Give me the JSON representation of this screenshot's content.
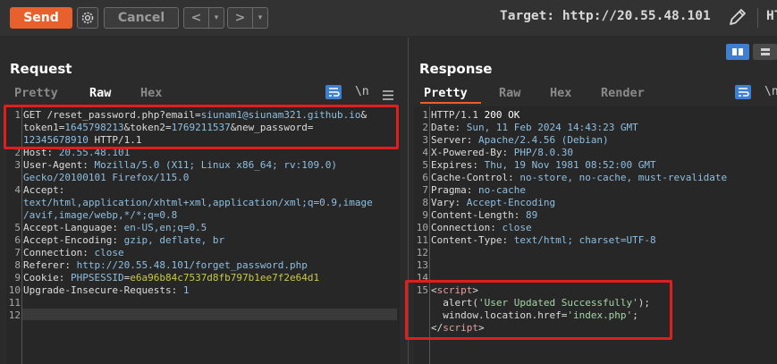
{
  "toolbar": {
    "send_label": "Send",
    "cancel_label": "Cancel",
    "back_label": "<",
    "forward_label": ">",
    "dropdown_arrow": "▾",
    "target_label": "Target: http://20.55.48.101",
    "cut_text": "HT",
    "icons": [
      "settings-gear-icon",
      "edit-pencil-icon"
    ]
  },
  "request": {
    "title": "Request",
    "tabs": [
      "Pretty",
      "Raw",
      "Hex"
    ],
    "active_tab": "Raw",
    "newline_toggle": "\\n",
    "lines": [
      {
        "n": "1",
        "parts": [
          {
            "t": "GET /reset_password.php?email=",
            "c": "k"
          },
          {
            "t": "siunam1@siunam321.github.io",
            "c": "v"
          },
          {
            "t": "&",
            "c": "k"
          }
        ]
      },
      {
        "n": "",
        "parts": [
          {
            "t": "token1=",
            "c": "k"
          },
          {
            "t": "1645798213",
            "c": "v"
          },
          {
            "t": "&token2=",
            "c": "k"
          },
          {
            "t": "1769211537",
            "c": "v"
          },
          {
            "t": "&new_password=",
            "c": "k"
          }
        ]
      },
      {
        "n": "",
        "parts": [
          {
            "t": "12345678910",
            "c": "v"
          },
          {
            "t": " HTTP/1.1",
            "c": "k"
          }
        ]
      },
      {
        "n": "2",
        "parts": [
          {
            "t": "Host: ",
            "c": "k"
          },
          {
            "t": "20.55.48.101",
            "c": "v"
          }
        ]
      },
      {
        "n": "3",
        "parts": [
          {
            "t": "User-Agent: ",
            "c": "k"
          },
          {
            "t": "Mozilla/5.0 (X11; Linux x86_64; rv:109.0)",
            "c": "v"
          }
        ]
      },
      {
        "n": "",
        "parts": [
          {
            "t": "Gecko/20100101 Firefox/115.0",
            "c": "v"
          }
        ]
      },
      {
        "n": "4",
        "parts": [
          {
            "t": "Accept:",
            "c": "k"
          }
        ]
      },
      {
        "n": "",
        "parts": [
          {
            "t": "text/html,application/xhtml+xml,application/xml;q=0.9,image",
            "c": "v"
          }
        ]
      },
      {
        "n": "",
        "parts": [
          {
            "t": "/avif,image/webp,*/*;q=0.8",
            "c": "v"
          }
        ]
      },
      {
        "n": "5",
        "parts": [
          {
            "t": "Accept-Language: ",
            "c": "k"
          },
          {
            "t": "en-US,en;q=0.5",
            "c": "v"
          }
        ]
      },
      {
        "n": "6",
        "parts": [
          {
            "t": "Accept-Encoding: ",
            "c": "k"
          },
          {
            "t": "gzip, deflate, br",
            "c": "v"
          }
        ]
      },
      {
        "n": "7",
        "parts": [
          {
            "t": "Connection: ",
            "c": "k"
          },
          {
            "t": "close",
            "c": "v"
          }
        ]
      },
      {
        "n": "8",
        "parts": [
          {
            "t": "Referer: ",
            "c": "k"
          },
          {
            "t": "http://20.55.48.101/forget_password.php",
            "c": "v"
          }
        ]
      },
      {
        "n": "9",
        "parts": [
          {
            "t": "Cookie: ",
            "c": "k"
          },
          {
            "t": "PHPSESSID",
            "c": "v"
          },
          {
            "t": "=",
            "c": "k"
          },
          {
            "t": "e6a96b84c7537d8fb797b1ee7f2e64d1",
            "c": "pv"
          }
        ]
      },
      {
        "n": "10",
        "parts": [
          {
            "t": "Upgrade-Insecure-Requests: ",
            "c": "k"
          },
          {
            "t": "1",
            "c": "v"
          }
        ]
      },
      {
        "n": "11",
        "parts": []
      },
      {
        "n": "12",
        "parts": []
      }
    ]
  },
  "response": {
    "title": "Response",
    "tabs": [
      "Pretty",
      "Raw",
      "Hex",
      "Render"
    ],
    "active_tab": "Pretty",
    "newline_toggle": "\\n",
    "lines": [
      {
        "n": "1",
        "parts": [
          {
            "t": "HTTP/1.1 ",
            "c": "k"
          },
          {
            "t": "200 OK",
            "c": "ok"
          }
        ]
      },
      {
        "n": "2",
        "parts": [
          {
            "t": "Date: ",
            "c": "k"
          },
          {
            "t": "Sun, 11 Feb 2024 14:43:23 GMT",
            "c": "v"
          }
        ]
      },
      {
        "n": "3",
        "parts": [
          {
            "t": "Server: ",
            "c": "k"
          },
          {
            "t": "Apache/2.4.56 (Debian)",
            "c": "v"
          }
        ]
      },
      {
        "n": "4",
        "parts": [
          {
            "t": "X-Powered-By: ",
            "c": "k"
          },
          {
            "t": "PHP/8.0.30",
            "c": "v"
          }
        ]
      },
      {
        "n": "5",
        "parts": [
          {
            "t": "Expires: ",
            "c": "k"
          },
          {
            "t": "Thu, 19 Nov 1981 08:52:00 GMT",
            "c": "v"
          }
        ]
      },
      {
        "n": "6",
        "parts": [
          {
            "t": "Cache-Control: ",
            "c": "k"
          },
          {
            "t": "no-store, no-cache, must-revalidate",
            "c": "v"
          }
        ]
      },
      {
        "n": "7",
        "parts": [
          {
            "t": "Pragma: ",
            "c": "k"
          },
          {
            "t": "no-cache",
            "c": "v"
          }
        ]
      },
      {
        "n": "8",
        "parts": [
          {
            "t": "Vary: ",
            "c": "k"
          },
          {
            "t": "Accept-Encoding",
            "c": "v"
          }
        ]
      },
      {
        "n": "9",
        "parts": [
          {
            "t": "Content-Length: ",
            "c": "k"
          },
          {
            "t": "89",
            "c": "v"
          }
        ]
      },
      {
        "n": "10",
        "parts": [
          {
            "t": "Connection: ",
            "c": "k"
          },
          {
            "t": "close",
            "c": "v"
          }
        ]
      },
      {
        "n": "11",
        "parts": [
          {
            "t": "Content-Type: ",
            "c": "k"
          },
          {
            "t": "text/html; charset=UTF-8",
            "c": "v"
          }
        ]
      },
      {
        "n": "12",
        "parts": []
      },
      {
        "n": "13",
        "parts": []
      },
      {
        "n": "14",
        "parts": []
      },
      {
        "n": "15",
        "parts": [
          {
            "t": "<",
            "c": "k"
          },
          {
            "t": "script",
            "c": "tagc"
          },
          {
            "t": ">",
            "c": "k"
          }
        ]
      },
      {
        "n": "",
        "parts": [
          {
            "t": "  alert(",
            "c": "k"
          },
          {
            "t": "'User Updated Successfully'",
            "c": "str"
          },
          {
            "t": ");",
            "c": "k"
          }
        ]
      },
      {
        "n": "",
        "parts": [
          {
            "t": "  window.location.href=",
            "c": "k"
          },
          {
            "t": "'index.php'",
            "c": "str"
          },
          {
            "t": ";",
            "c": "k"
          }
        ]
      },
      {
        "n": "",
        "parts": [
          {
            "t": "</",
            "c": "k"
          },
          {
            "t": "script",
            "c": "tagc"
          },
          {
            "t": ">",
            "c": "k"
          }
        ]
      }
    ]
  },
  "colors": {
    "accent": "#e8612c",
    "highlight_box": "#e01e1e",
    "active_toggle": "#3f7fd1"
  }
}
